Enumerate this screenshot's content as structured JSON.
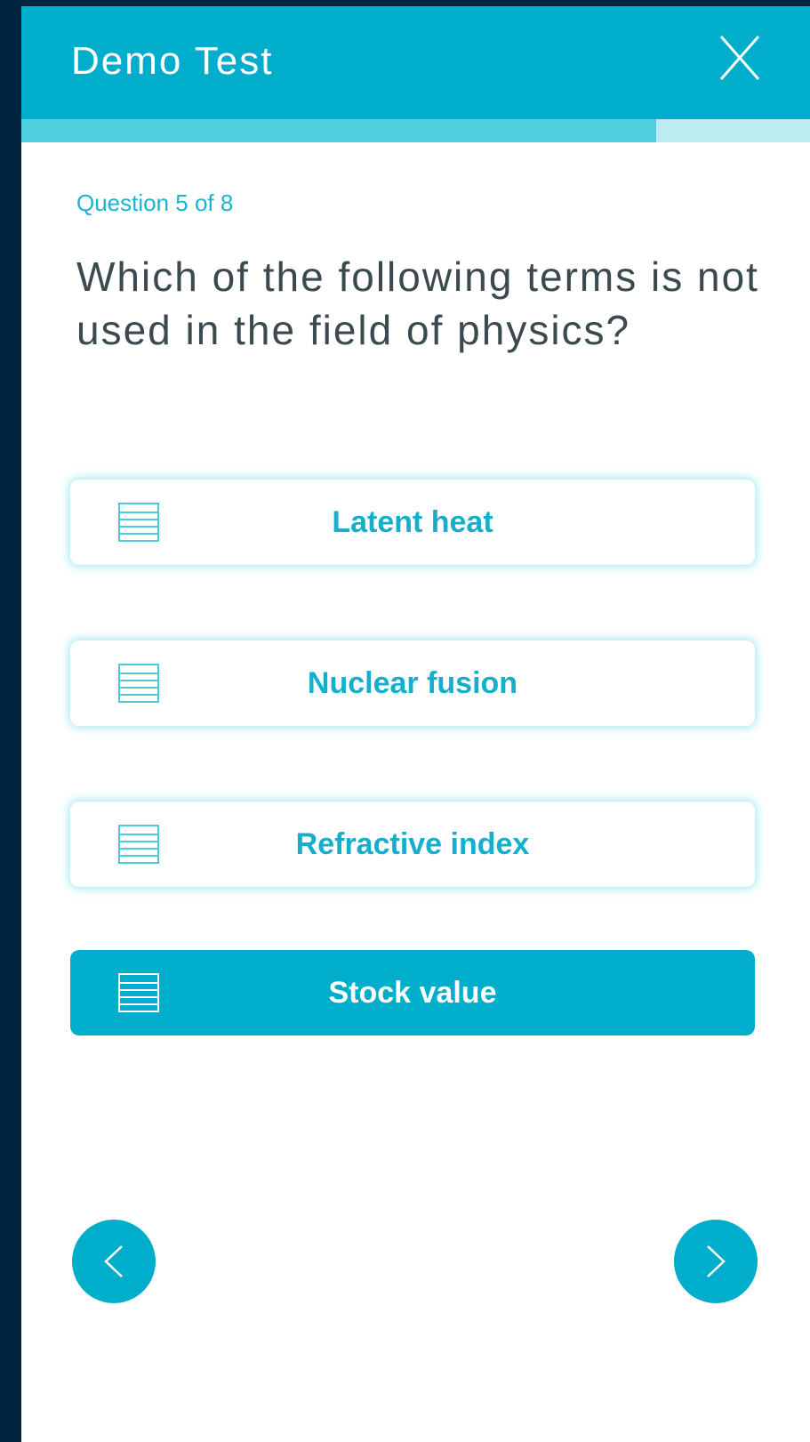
{
  "header": {
    "title": "Demo Test"
  },
  "progress": {
    "current": 5,
    "total": 8,
    "fraction": 0.805
  },
  "question": {
    "counter": "Question 5 of 8",
    "text": "Which of the following terms is not used in the field of physics?"
  },
  "options": [
    {
      "label": "Latent heat",
      "icon": "document-lines-icon",
      "selected": false
    },
    {
      "label": "Nuclear fusion",
      "icon": "document-lines-icon",
      "selected": false
    },
    {
      "label": "Refractive index",
      "icon": "document-lines-icon",
      "selected": false
    },
    {
      "label": "Stock value",
      "icon": "document-lines-icon",
      "selected": true
    }
  ],
  "navigation": {
    "prev_icon": "chevron-left-icon",
    "next_icon": "chevron-right-icon",
    "close_icon": "close-icon"
  },
  "colors": {
    "accent": "#00aecb",
    "progress_fill": "#4fd0de",
    "progress_track": "#bdebf2",
    "question_text": "#3a4a4f",
    "outer_background": "#03243e"
  }
}
